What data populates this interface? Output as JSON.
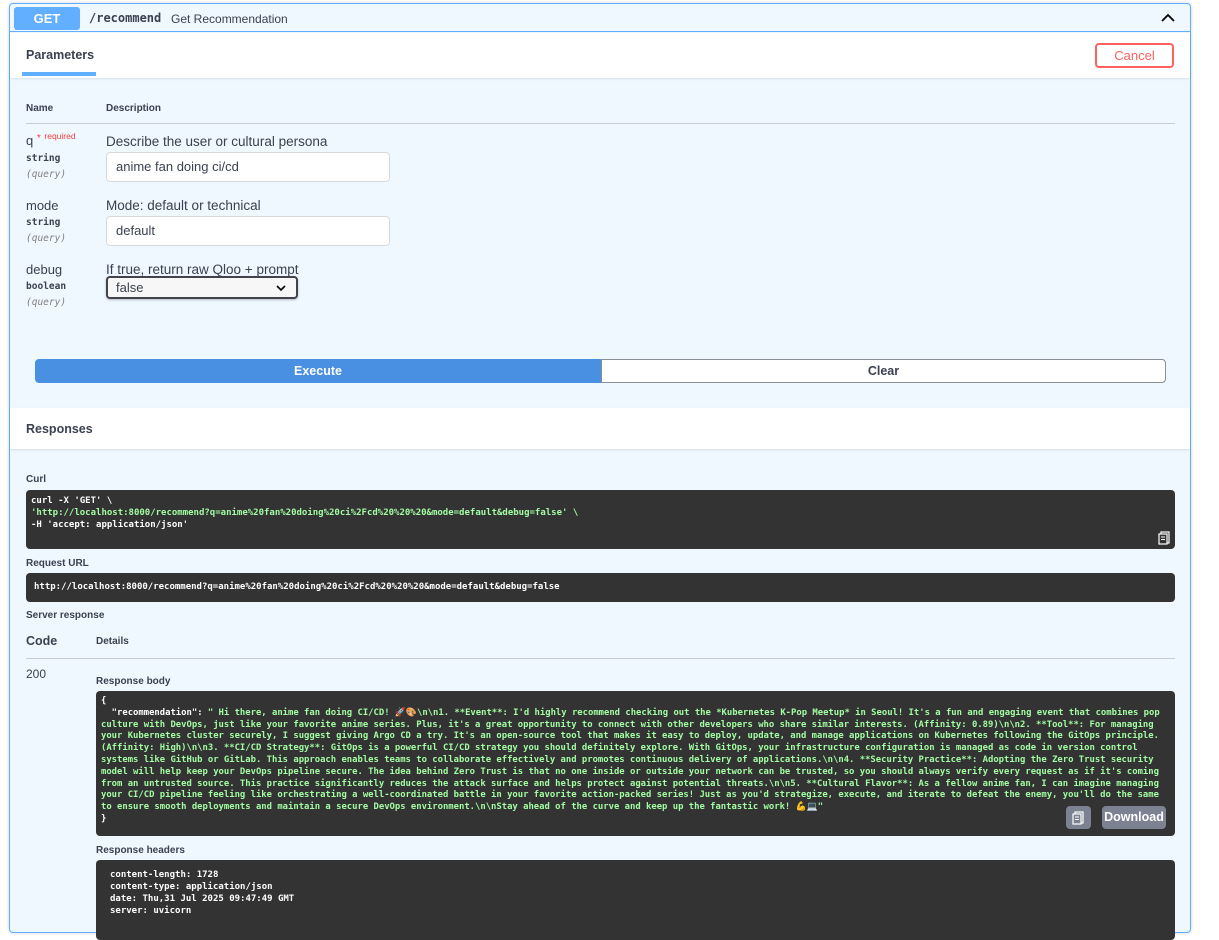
{
  "operation": {
    "method": "GET",
    "path": "/recommend",
    "summary": "Get Recommendation"
  },
  "params_section": {
    "tab_label": "Parameters",
    "cancel_label": "Cancel",
    "col_name": "Name",
    "col_description": "Description",
    "required_label": "required",
    "params": [
      {
        "name": "q",
        "type": "string",
        "in": "(query)",
        "description": "Describe the user or cultural persona",
        "value": "anime fan doing ci/cd",
        "required": true
      },
      {
        "name": "mode",
        "type": "string",
        "in": "(query)",
        "description": "Mode: default or technical",
        "value": "default",
        "required": false
      },
      {
        "name": "debug",
        "type": "boolean",
        "in": "(query)",
        "description": "If true, return raw Qloo + prompt",
        "value": "false",
        "required": false
      }
    ]
  },
  "actions": {
    "execute_label": "Execute",
    "clear_label": "Clear"
  },
  "responses": {
    "title": "Responses",
    "curl_label": "Curl",
    "curl_line1": "curl -X 'GET' \\",
    "curl_line2": "  'http://localhost:8000/recommend?q=anime%20fan%20doing%20ci%2Fcd%20%20%20&mode=default&debug=false' \\",
    "curl_line3": "  -H 'accept: application/json'",
    "request_url_label": "Request URL",
    "request_url": "http://localhost:8000/recommend?q=anime%20fan%20doing%20ci%2Fcd%20%20%20&mode=default&debug=false",
    "server_response_label": "Server response",
    "code_header": "Code",
    "details_header": "Details",
    "status_code": "200",
    "response_body_label": "Response body",
    "body_open": "{",
    "body_key": "  \"recommendation\"",
    "body_value": "\" Hi there, anime fan doing CI/CD! 🚀🎨\\n\\n1. **Event**: I'd highly recommend checking out the *Kubernetes K-Pop Meetup* in Seoul! It's a fun and engaging event that combines pop culture with DevOps, just like your favorite anime series. Plus, it's a great opportunity to connect with other developers who share similar interests. (Affinity: 0.89)\\n\\n2. **Tool**: For managing your Kubernetes cluster securely, I suggest giving Argo CD a try. It's an open-source tool that makes it easy to deploy, update, and manage applications on Kubernetes following the GitOps principle. (Affinity: High)\\n\\n3. **CI/CD Strategy**: GitOps is a powerful CI/CD strategy you should definitely explore. With GitOps, your infrastructure configuration is managed as code in version control systems like GitHub or GitLab. This approach enables teams to collaborate effectively and promotes continuous delivery of applications.\\n\\n4. **Security Practice**: Adopting the Zero Trust security model will help keep your DevOps pipeline secure. The idea behind Zero Trust is that no one inside or outside your network can be trusted, so you should always verify every request as if it's coming from an untrusted source. This practice significantly reduces the attack surface and helps protect against potential threats.\\n\\n5. **Cultural Flavor**: As a fellow anime fan, I can imagine managing your CI/CD pipeline feeling like orchestrating a well-coordinated battle in your favorite action-packed series! Just as you'd strategize, execute, and iterate to defeat the enemy, you'll do the same to ensure smooth deployments and maintain a secure DevOps environment.\\n\\nStay ahead of the curve and keep up the fantastic work! 💪💻\"",
    "body_close": "}",
    "download_label": "Download",
    "response_headers_label": "Response headers",
    "headers": [
      "content-length: 1728",
      "content-type: application/json",
      "date: Thu,31 Jul 2025 09:47:49 GMT",
      "server: uvicorn"
    ]
  },
  "colors": {
    "get_accent": "#61affe",
    "execute": "#4990e2",
    "cancel": "#ff6060",
    "code_bg": "#333333",
    "string": "#a2fca2"
  }
}
